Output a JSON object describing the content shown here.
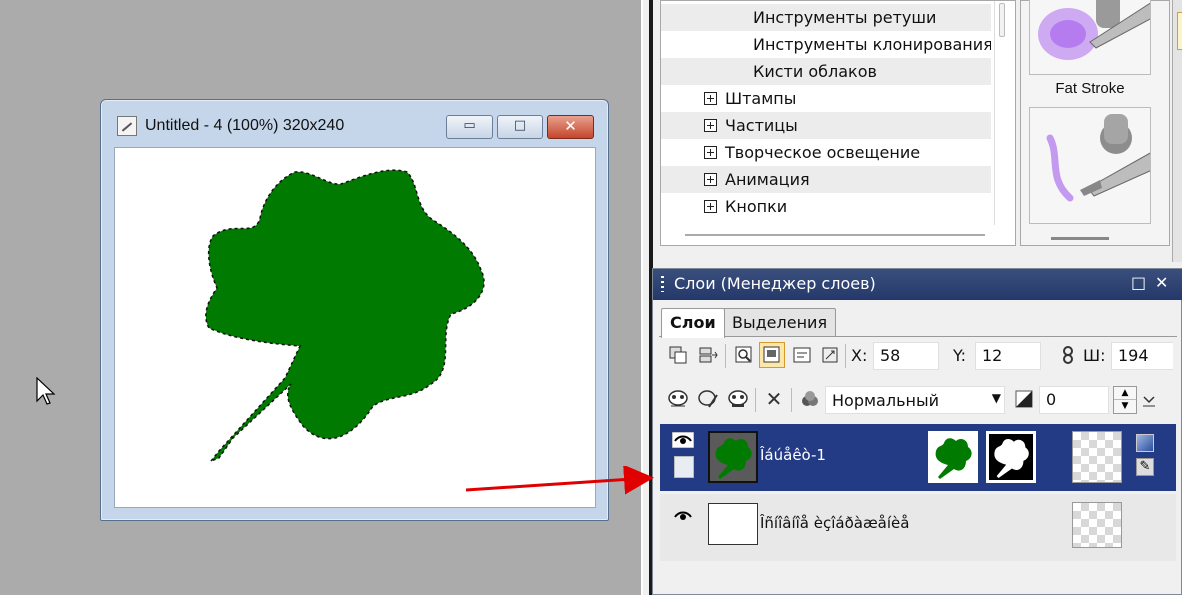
{
  "document_window": {
    "title": "Untitled - 4 (100%) 320x240",
    "buttons": {
      "minimize": "▭",
      "maximize": "□",
      "close": "✕"
    }
  },
  "effects_tree": {
    "items": [
      {
        "label": "Инструменты  ретуши",
        "expandable": false
      },
      {
        "label": "Инструменты  клонирования",
        "expandable": false
      },
      {
        "label": "Кисти облаков",
        "expandable": false
      },
      {
        "label": "Штампы",
        "expandable": true
      },
      {
        "label": "Частицы",
        "expandable": true
      },
      {
        "label": "Творческое  освещение",
        "expandable": true
      },
      {
        "label": "Анимация",
        "expandable": true
      },
      {
        "label": "Кнопки",
        "expandable": true
      }
    ]
  },
  "brush_panel": {
    "items": [
      {
        "label": "Fat Stroke"
      }
    ]
  },
  "layers_panel": {
    "title": "Слои (Менеджер слоев)",
    "header_buttons": {
      "restore": "□",
      "close": "✕"
    },
    "tabs": [
      {
        "label": "Слои",
        "active": true
      },
      {
        "label": "Выделения",
        "active": false
      }
    ],
    "position": {
      "x_label": "X:",
      "x_value": "58",
      "y_label": "Y:",
      "y_value": "12",
      "w_label": "Ш:",
      "w_value": "194"
    },
    "blend_mode": "Нормальный",
    "opacity": "0",
    "layers": [
      {
        "name": "Îáúåêò-1",
        "selected": true
      },
      {
        "name": "Îñíîâíîå èçîáðàæåíèå",
        "selected": false
      }
    ]
  },
  "colors": {
    "accent": "#233a84",
    "leaf": "#007a00",
    "annotation_arrow": "#e00000",
    "workspace": "#ababab"
  },
  "icons": [
    "document-icon",
    "cursor-icon",
    "eye-icon",
    "delete-x-icon",
    "color-balls-icon",
    "annotation-arrow"
  ]
}
